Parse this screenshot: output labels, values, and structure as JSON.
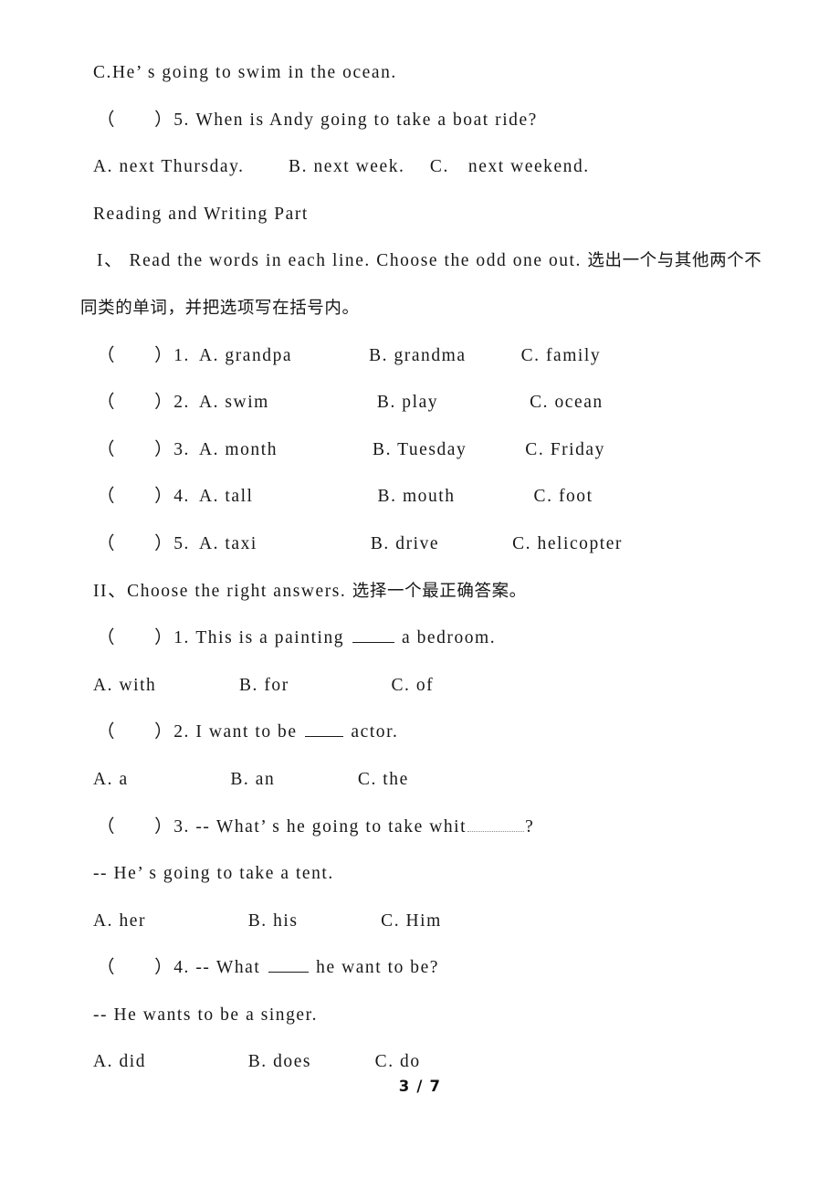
{
  "document": {
    "page_label": "3 / 7",
    "page_number": 3,
    "page_total": 7
  },
  "listening_tail": {
    "option_c": "C.He’ s going to swim in the ocean.",
    "question_5": "（　　）5. When is Andy going to take a boat ride?",
    "q5_options": "A. next Thursday.　　 B. next week.　 C.　next weekend."
  },
  "section_heading": "Reading and Writing Part",
  "part_one": {
    "instruction_en": "I、 Read the words in each line. Choose the odd one out. ",
    "instruction_cn": "选出一个与其他两个不同类",
    "instruction_cn_2": "的单词，并把选项写在括号内。",
    "items": [
      {
        "bracket": "（　　）",
        "number": "1.",
        "a": "A. grandpa",
        "b": "B. grandma",
        "c": "C. family"
      },
      {
        "bracket": "（　　）",
        "number": "2.",
        "a": "A. swim",
        "b": "B. play",
        "c": "C. ocean"
      },
      {
        "bracket": "（　　）",
        "number": "3.",
        "a": "A. month",
        "b": "B. Tuesday",
        "c": "C. Friday"
      },
      {
        "bracket": "（　　）",
        "number": "4.",
        "a": "A. tall",
        "b": "B. mouth",
        "c": "C. foot"
      },
      {
        "bracket": "（　　）",
        "number": "5.",
        "a": "A. taxi",
        "b": "B. drive",
        "c": "C. helicopter"
      }
    ]
  },
  "part_two": {
    "instruction_en": "II、Choose the right answers. ",
    "instruction_cn": "选择一个最正确答案。",
    "items": [
      {
        "stem_prefix": "（　　）1. This is a painting ",
        "stem_suffix": " a bedroom.",
        "blank_style": "solid",
        "reply": "",
        "options": "A. with　　　　 B. for　　　　　 C. of"
      },
      {
        "stem_prefix": "（　　）2. I want to be ",
        "stem_suffix": " actor.",
        "blank_style": "solid",
        "reply": "",
        "options": "A. a　　　　　 B. an　　　　 C. the"
      },
      {
        "stem_prefix": "（　　）3. -- What’ s he going to take whit",
        "stem_suffix": "?",
        "blank_style": "dotted",
        "reply": "-- He’ s going to take a tent.",
        "options": "A. her　　　　　 B. his　　　　 C. Him"
      },
      {
        "stem_prefix": "（　　）4. -- What ",
        "stem_suffix": " he want to be?",
        "blank_style": "solid",
        "reply": "-- He wants to be a singer.",
        "options": "A. did　　　　　 B. does　　　 C. do"
      }
    ]
  }
}
